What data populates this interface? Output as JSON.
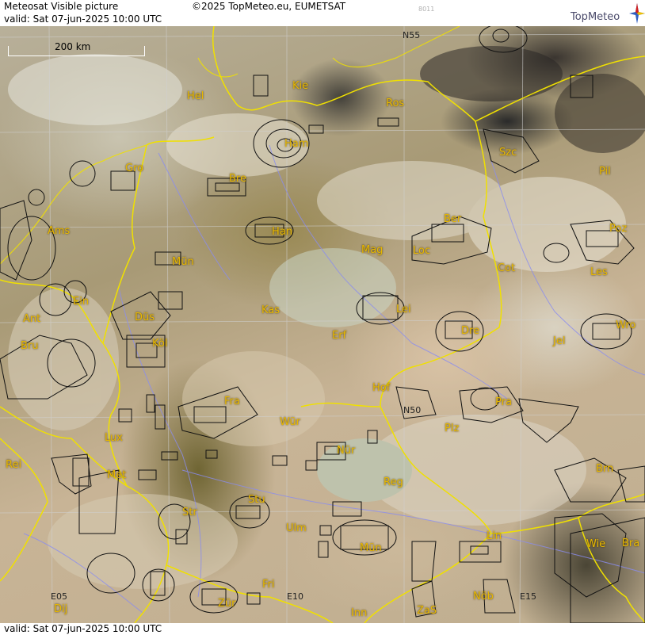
{
  "header": {
    "title": "Meteosat Visible picture",
    "valid": "valid:  Sat  07-jun-2025  10:00 UTC",
    "copyright": "©2025 TopMeteo.eu, EUMETSAT",
    "code": "8011"
  },
  "logo": {
    "brand": "TopMeteo",
    "icon": "compass-star-icon"
  },
  "scale": {
    "label": "200 km"
  },
  "grid_labels": {
    "n55": "N55",
    "n50": "N50",
    "e05": "E05",
    "e10": "E10",
    "e15": "E15"
  },
  "cities": {
    "hel": "Hel",
    "kie": "Kie",
    "ros": "Ros",
    "ham": "Ham",
    "szc": "Szc",
    "pil": "Pil",
    "gro": "Gro",
    "bre": "Bre",
    "ber": "Ber",
    "ams": "Ams",
    "han": "Han",
    "poz": "Poz",
    "mag": "Mag",
    "loc": "Loc",
    "cot": "Cot",
    "mun": "Mün",
    "les": "Les",
    "ein": "Ein",
    "kas": "Kas",
    "lei": "Lei",
    "ant": "Ant",
    "dus": "Düs",
    "wro": "Wro",
    "bru": "Bru",
    "kol": "Köl",
    "erf": "Erf",
    "dre": "Dre",
    "jel": "Jel",
    "hof": "Hof",
    "fra": "Fra",
    "pra": "Pra",
    "wur": "Wür",
    "plz": "Plz",
    "lux": "Lux",
    "nur": "Nür",
    "rei": "Rei",
    "met": "Met",
    "reg": "Reg",
    "brn": "Brn",
    "stu": "Stu",
    "str": "Str",
    "ulm": "Ulm",
    "lin": "Lin",
    "mun2": "Mün",
    "wie": "Wie",
    "bra": "Bra",
    "fri": "Fri",
    "nob": "Nöb",
    "dij": "Dij",
    "zur": "Zür",
    "inn": "Inn",
    "zas": "ZaS"
  },
  "footer": {
    "valid": "valid:  Sat  07-jun-2025  10:00 UTC"
  },
  "colors": {
    "border": "#f0e000",
    "city": "#e8b800",
    "river": "#8a8cf0",
    "grid": "#d0d0d0"
  }
}
